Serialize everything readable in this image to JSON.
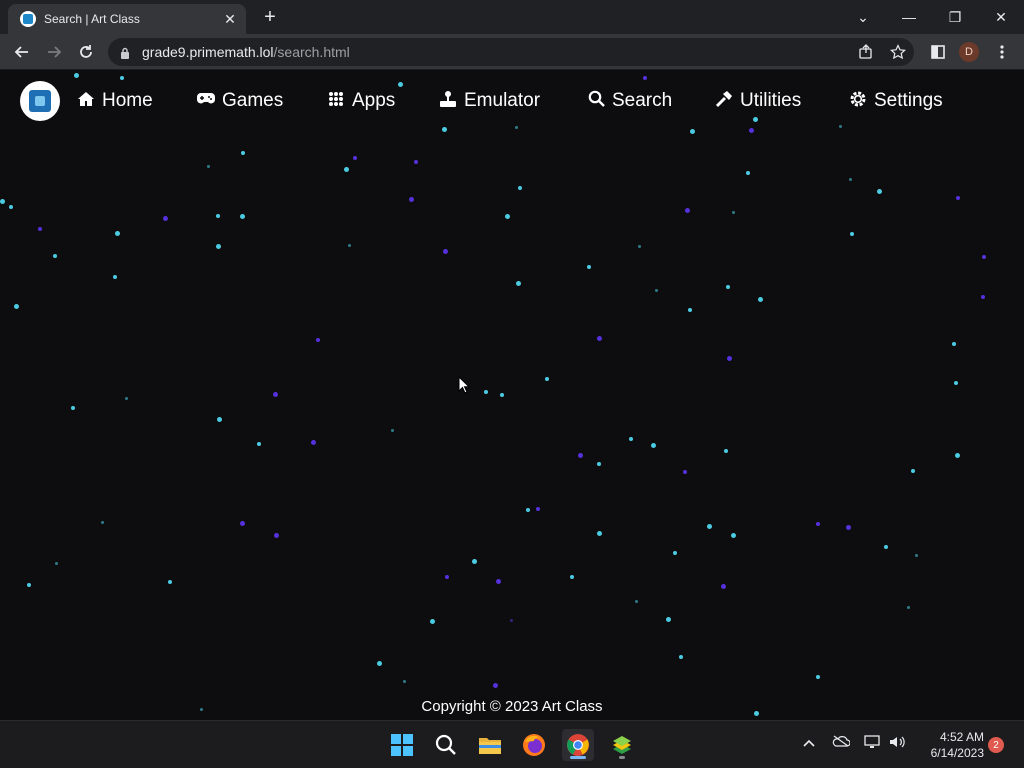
{
  "browser": {
    "tab_title": "Search | Art Class",
    "tab_close": "✕",
    "new_tab": "+",
    "url_host": "grade9.primemath.lol",
    "url_path": "/search.html",
    "profile_initial": "D",
    "window_controls": [
      "⌄",
      "—",
      "❐",
      "✕"
    ]
  },
  "site": {
    "nav": [
      {
        "label": "Home",
        "icon": "home-icon"
      },
      {
        "label": "Games",
        "icon": "gamepad-icon"
      },
      {
        "label": "Apps",
        "icon": "grid-icon"
      },
      {
        "label": "Emulator",
        "icon": "joystick-icon"
      },
      {
        "label": "Search",
        "icon": "search-icon"
      },
      {
        "label": "Utilities",
        "icon": "hammer-icon"
      },
      {
        "label": "Settings",
        "icon": "gear-icon"
      }
    ],
    "footer": "Copyright © 2023 Art Class",
    "colors": {
      "background": "#0d0d0f",
      "star_cyan": "#4fd6ee",
      "star_purple": "#5a34e8"
    }
  },
  "taskbar": {
    "apps": [
      "windows-start",
      "search",
      "file-explorer",
      "firefox",
      "chrome",
      "bluestacks"
    ],
    "time": "4:52 AM",
    "date": "6/14/2023",
    "notification_count": "2"
  }
}
